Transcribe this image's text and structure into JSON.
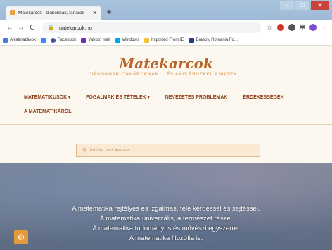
{
  "browser": {
    "tab_title": "Matekarcok - diákoknak, tanárok",
    "tab_close": "✕",
    "new_tab": "+",
    "url": "matekarcok.hu",
    "bookmarks": [
      {
        "label": "Alkalmazások",
        "color": "#4a7bd6"
      },
      {
        "label": "G",
        "color": "#4285f4"
      },
      {
        "label": "Facebook",
        "color": "#3b5998"
      },
      {
        "label": "Yahoo! mail",
        "color": "#6b2fb3"
      },
      {
        "label": "Windows",
        "color": "#00a4ef"
      },
      {
        "label": "Imported From IE",
        "color": "#f1c232"
      },
      {
        "label": "Brasov, Romania Fo...",
        "color": "#1c3f7a"
      }
    ]
  },
  "site": {
    "logo": "Matekarcok",
    "tagline": "DIÁKOKNAK, TANÁROKNAK ... ÉS AKIT ÉRDEKEL A MATEK ...",
    "menu": [
      {
        "label": "MATEMATIKUSOK",
        "caret": "▾"
      },
      {
        "label": "FOGALMAK ÉS TÉTELEK",
        "caret": "▾"
      },
      {
        "label": "NEVEZETES PROBLÉMÁK",
        "caret": ""
      },
      {
        "label": "ÉRDEKESSÉGEK",
        "caret": ""
      }
    ],
    "menu2": [
      {
        "label": "A MATEMATIKÁRÓL"
      }
    ],
    "search_placeholder": "Írd ide, amit keresel...",
    "hero_lines": [
      "A matematika rejtélyes és izgalmas, tele kérdéssel és sejtéssel.",
      "A matematika univerzális, a természet része.",
      "A matematika tudományos és művészi egyszerre.",
      "A matematika filozófia is."
    ]
  },
  "colors": {
    "accent": "#8b3f1a",
    "logo": "#b7652b",
    "gear_bg": "#e39a3a"
  }
}
